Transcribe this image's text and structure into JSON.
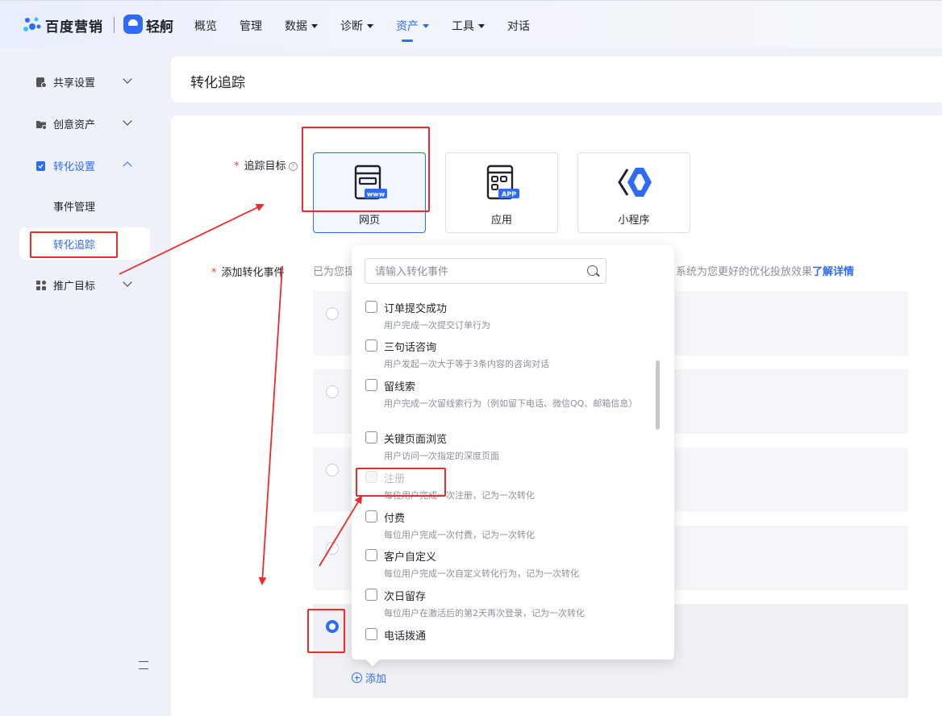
{
  "brand": {
    "name": "百度营销",
    "product": "轻舸"
  },
  "nav": {
    "items": [
      {
        "label": "概览",
        "has_caret": false
      },
      {
        "label": "管理",
        "has_caret": false
      },
      {
        "label": "数据",
        "has_caret": true
      },
      {
        "label": "诊断",
        "has_caret": true
      },
      {
        "label": "资产",
        "has_caret": true,
        "active": true
      },
      {
        "label": "工具",
        "has_caret": true
      },
      {
        "label": "对话",
        "has_caret": false
      }
    ]
  },
  "sidebar": {
    "items": [
      {
        "label": "共享设置",
        "expanded": false
      },
      {
        "label": "创意资产",
        "expanded": false
      },
      {
        "label": "转化设置",
        "expanded": true
      },
      {
        "label": "推广目标",
        "expanded": false
      }
    ],
    "sub_items": [
      "事件管理",
      "转化追踪"
    ],
    "active_sub": "转化追踪"
  },
  "page": {
    "title": "转化追踪"
  },
  "form": {
    "track_target_label": "追踪目标",
    "help_glyph": "?",
    "required_mark": "*",
    "targets": [
      {
        "label": "网页",
        "badge": "www",
        "selected": true
      },
      {
        "label": "应用",
        "badge": "APP",
        "selected": false
      },
      {
        "label": "小程序",
        "selected": false
      }
    ],
    "add_event_label": "添加转化事件",
    "desc_prefix": "已为您提",
    "desc_suffix": "系统为您更好的优化投放效果",
    "desc_link": "了解详情",
    "add_button": "添加"
  },
  "dropdown": {
    "search_placeholder": "请输入转化事件",
    "options": [
      {
        "name": "订单提交成功",
        "desc": "用户完成一次提交订单行为",
        "disabled": false
      },
      {
        "name": "三句话咨询",
        "desc": "用户发起一次大于等于3条内容的咨询对话",
        "disabled": false
      },
      {
        "name": "留线索",
        "desc": "用户完成一次留线索行为（例如留下电话、微信QQ、邮箱信息）",
        "disabled": false
      },
      {
        "name": "关键页面浏览",
        "desc": "用户访问一次指定的深度页面",
        "disabled": false
      },
      {
        "name": "注册",
        "desc": "每位用户完成一次注册，记为一次转化",
        "disabled": true
      },
      {
        "name": "付费",
        "desc": "每位用户完成一次付费，记为一次转化",
        "disabled": false
      },
      {
        "name": "客户自定义",
        "desc": "每位用户完成一次自定义转化行为，记为一次转化",
        "disabled": false
      },
      {
        "name": "次日留存",
        "desc": "每位用户在激活后的第2天再次登录，记为一次转化",
        "disabled": false
      },
      {
        "name": "电话拨通",
        "desc": "",
        "disabled": false
      }
    ]
  },
  "colors": {
    "accent": "#2f6cf5",
    "annotation": "#ee2a2a",
    "required": "#e54545"
  }
}
